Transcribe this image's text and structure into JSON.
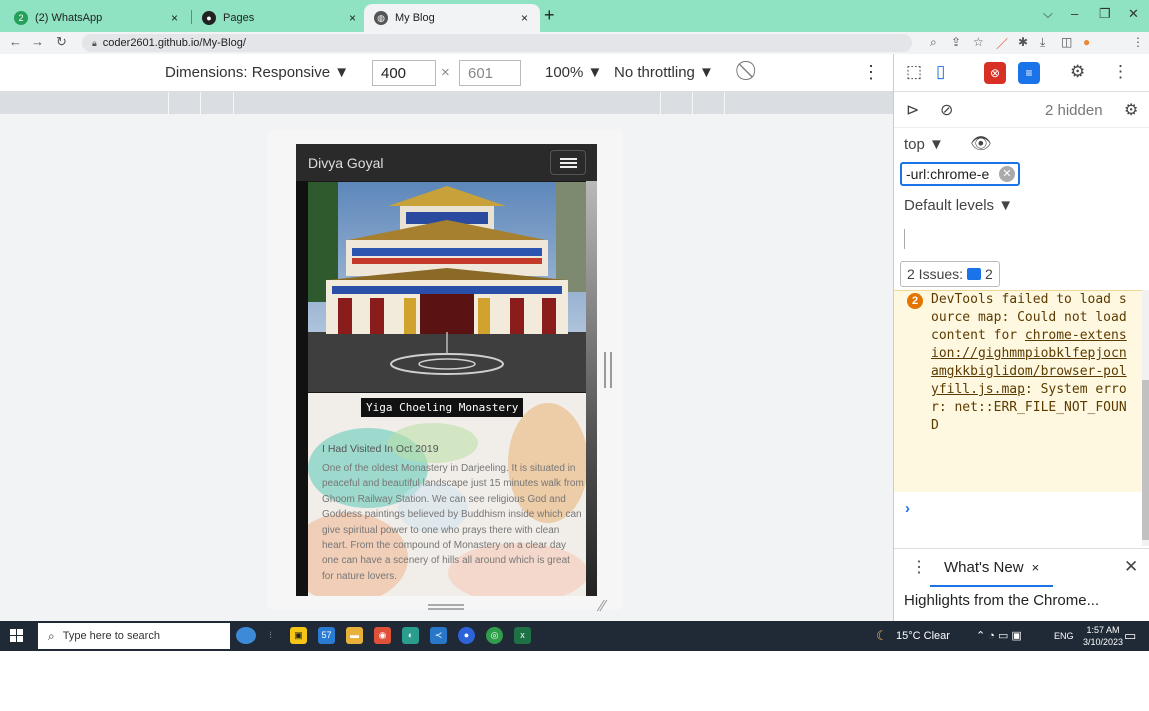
{
  "tabs": [
    {
      "label": "(2) WhatsApp",
      "icon": "whatsapp-icon",
      "close": "×"
    },
    {
      "label": "Pages",
      "icon": "github-icon",
      "close": "×"
    },
    {
      "label": "My Blog",
      "icon": "globe-icon",
      "close": "×"
    }
  ],
  "new_tab": "+",
  "window_controls": {
    "chevron": "⌵",
    "minimize": "–",
    "maximize": "❐",
    "close": "✕"
  },
  "address": {
    "url": "coder2601.github.io/My-Blog/"
  },
  "device_toolbar": {
    "dimensions_label": "Dimensions: Responsive ▼",
    "width": "400",
    "times": "×",
    "height": "601",
    "zoom": "100% ▼",
    "throttling": "No throttling ▼"
  },
  "site": {
    "brand": "Divya Goyal",
    "caption": "Yiga Choeling Monastery",
    "visited": "I Had Visited In Oct 2019",
    "description": "One of the oldest Monastery in Darjeeling. It is situated in peaceful and beautiful landscape just 15 minutes walk from Ghoom Railway Station. We can see religious God and Goddess paintings believed by Buddhism inside which can give spiritual power to one who prays there with clean heart. From the compound of Monastery on a clear day one can have a scenery of hills all around which is great for nature lovers."
  },
  "devtools": {
    "hidden": "2 hidden",
    "context": "top ▼",
    "filter": "-url:chrome-e",
    "levels": "Default levels ▼",
    "issues_label": "2 Issues:",
    "issues_count": "2",
    "message_count": "2",
    "message_pre": "DevTools failed to load source map: Could not load content for ",
    "message_link": "chrome-extension://gighmmpiobklfepjocnamgkkbiglidom/browser-polyfill.js.map",
    "message_post": ": System error: net::ERR_FILE_NOT_FOUND",
    "prompt": "›",
    "drawer_tab": "What's New",
    "drawer_tab_close": "×",
    "drawer_close": "✕",
    "highlights": "Highlights from the Chrome..."
  },
  "taskbar": {
    "search_placeholder": "Type here to search",
    "weather": "15°C  Clear",
    "lang": "ENG",
    "time": "1:57 AM",
    "date": "3/10/2023",
    "badge": "57"
  }
}
